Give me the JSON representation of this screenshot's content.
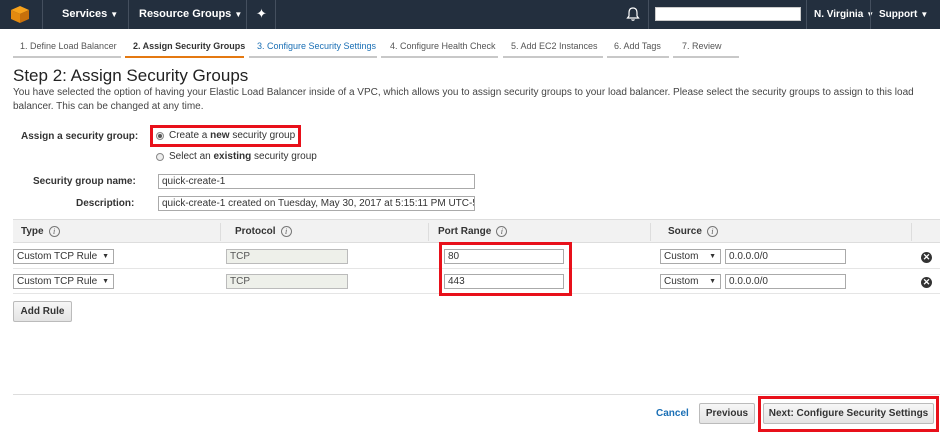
{
  "topbar": {
    "services": "Services",
    "resource_groups": "Resource Groups",
    "region": "N. Virginia",
    "support": "Support",
    "search_value": ""
  },
  "steps": [
    {
      "label": "1. Define Load Balancer"
    },
    {
      "label": "2. Assign Security Groups"
    },
    {
      "label": "3. Configure Security Settings"
    },
    {
      "label": "4. Configure Health Check"
    },
    {
      "label": "5. Add EC2 Instances"
    },
    {
      "label": "6. Add Tags"
    },
    {
      "label": "7. Review"
    }
  ],
  "page": {
    "title": "Step 2: Assign Security Groups",
    "description": "You have selected the option of having your Elastic Load Balancer inside of a VPC, which allows you to assign security groups to your load balancer. Please select the security groups to assign to this load balancer. This can be changed at any time."
  },
  "form": {
    "assign_label": "Assign a security group:",
    "option_new_pre": "Create a ",
    "option_new_bold": "new",
    "option_new_post": " security group",
    "option_existing_pre": "Select an ",
    "option_existing_bold": "existing",
    "option_existing_post": " security group",
    "selected_option": "new",
    "name_label": "Security group name:",
    "name_value": "quick-create-1",
    "description_label": "Description:",
    "description_value": "quick-create-1 created on Tuesday, May 30, 2017 at 5:15:11 PM UTC-5"
  },
  "table": {
    "headers": {
      "type": "Type",
      "protocol": "Protocol",
      "port_range": "Port Range",
      "source": "Source"
    },
    "info_glyph": "i",
    "rows": [
      {
        "type": "Custom TCP Rule",
        "protocol": "TCP",
        "port": "80",
        "source_type": "Custom",
        "source_cidr": "0.0.0.0/0"
      },
      {
        "type": "Custom TCP Rule",
        "protocol": "TCP",
        "port": "443",
        "source_type": "Custom",
        "source_cidr": "0.0.0.0/0"
      }
    ]
  },
  "buttons": {
    "add_rule": "Add Rule",
    "cancel": "Cancel",
    "previous": "Previous",
    "next": "Next: Configure Security Settings"
  },
  "colors": {
    "nav_bg": "#232f3e",
    "highlight_red": "#e8101a",
    "link_blue": "#1a6fb5",
    "active_step": "#e47911"
  }
}
